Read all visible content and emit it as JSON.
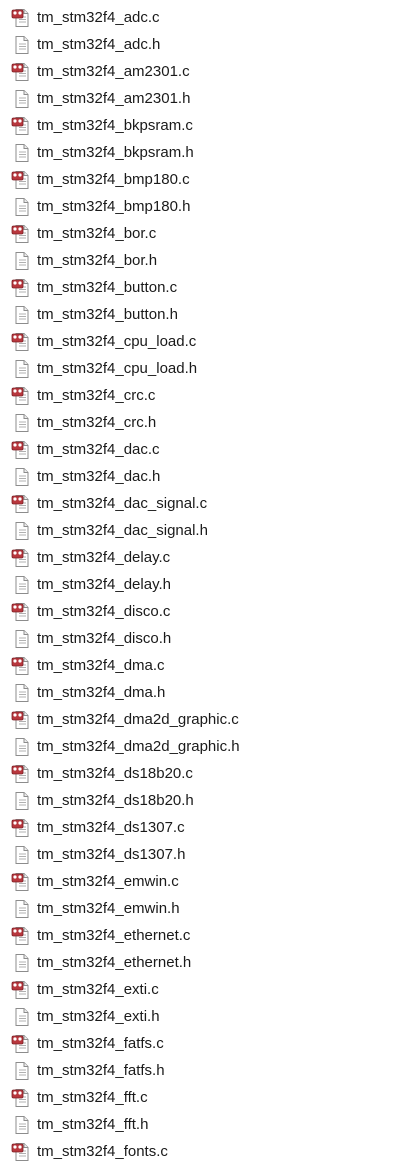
{
  "files": [
    {
      "name": "tm_stm32f4_adc.c",
      "type": "c-source"
    },
    {
      "name": "tm_stm32f4_adc.h",
      "type": "header"
    },
    {
      "name": "tm_stm32f4_am2301.c",
      "type": "c-source"
    },
    {
      "name": "tm_stm32f4_am2301.h",
      "type": "header"
    },
    {
      "name": "tm_stm32f4_bkpsram.c",
      "type": "c-source"
    },
    {
      "name": "tm_stm32f4_bkpsram.h",
      "type": "header"
    },
    {
      "name": "tm_stm32f4_bmp180.c",
      "type": "c-source"
    },
    {
      "name": "tm_stm32f4_bmp180.h",
      "type": "header"
    },
    {
      "name": "tm_stm32f4_bor.c",
      "type": "c-source"
    },
    {
      "name": "tm_stm32f4_bor.h",
      "type": "header"
    },
    {
      "name": "tm_stm32f4_button.c",
      "type": "c-source"
    },
    {
      "name": "tm_stm32f4_button.h",
      "type": "header"
    },
    {
      "name": "tm_stm32f4_cpu_load.c",
      "type": "c-source"
    },
    {
      "name": "tm_stm32f4_cpu_load.h",
      "type": "header"
    },
    {
      "name": "tm_stm32f4_crc.c",
      "type": "c-source"
    },
    {
      "name": "tm_stm32f4_crc.h",
      "type": "header"
    },
    {
      "name": "tm_stm32f4_dac.c",
      "type": "c-source"
    },
    {
      "name": "tm_stm32f4_dac.h",
      "type": "header"
    },
    {
      "name": "tm_stm32f4_dac_signal.c",
      "type": "c-source"
    },
    {
      "name": "tm_stm32f4_dac_signal.h",
      "type": "header"
    },
    {
      "name": "tm_stm32f4_delay.c",
      "type": "c-source"
    },
    {
      "name": "tm_stm32f4_delay.h",
      "type": "header"
    },
    {
      "name": "tm_stm32f4_disco.c",
      "type": "c-source"
    },
    {
      "name": "tm_stm32f4_disco.h",
      "type": "header"
    },
    {
      "name": "tm_stm32f4_dma.c",
      "type": "c-source"
    },
    {
      "name": "tm_stm32f4_dma.h",
      "type": "header"
    },
    {
      "name": "tm_stm32f4_dma2d_graphic.c",
      "type": "c-source"
    },
    {
      "name": "tm_stm32f4_dma2d_graphic.h",
      "type": "header"
    },
    {
      "name": "tm_stm32f4_ds18b20.c",
      "type": "c-source"
    },
    {
      "name": "tm_stm32f4_ds18b20.h",
      "type": "header"
    },
    {
      "name": "tm_stm32f4_ds1307.c",
      "type": "c-source"
    },
    {
      "name": "tm_stm32f4_ds1307.h",
      "type": "header"
    },
    {
      "name": "tm_stm32f4_emwin.c",
      "type": "c-source"
    },
    {
      "name": "tm_stm32f4_emwin.h",
      "type": "header"
    },
    {
      "name": "tm_stm32f4_ethernet.c",
      "type": "c-source"
    },
    {
      "name": "tm_stm32f4_ethernet.h",
      "type": "header"
    },
    {
      "name": "tm_stm32f4_exti.c",
      "type": "c-source"
    },
    {
      "name": "tm_stm32f4_exti.h",
      "type": "header"
    },
    {
      "name": "tm_stm32f4_fatfs.c",
      "type": "c-source"
    },
    {
      "name": "tm_stm32f4_fatfs.h",
      "type": "header"
    },
    {
      "name": "tm_stm32f4_fft.c",
      "type": "c-source"
    },
    {
      "name": "tm_stm32f4_fft.h",
      "type": "header"
    },
    {
      "name": "tm_stm32f4_fonts.c",
      "type": "c-source"
    }
  ],
  "icons": {
    "c-source": "c-source-file-icon",
    "header": "header-file-icon"
  },
  "colors": {
    "c_badge": "#b8373d",
    "c_badge_dark": "#7e1f24",
    "page_border": "#8c8c8c",
    "text": "#1a1a1a"
  }
}
